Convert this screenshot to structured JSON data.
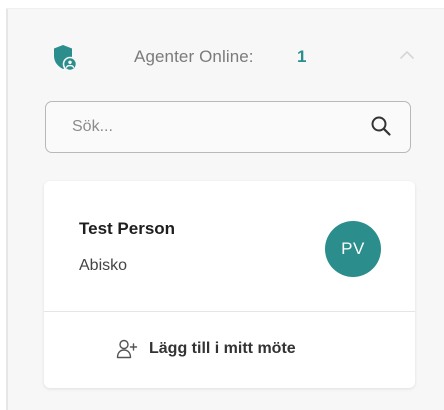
{
  "header": {
    "icon": "shield-user-icon",
    "label": "Agenter Online:",
    "count": "1",
    "collapse_icon": "chevron-up-icon"
  },
  "search": {
    "placeholder": "Sök...",
    "value": "",
    "icon": "search-icon"
  },
  "agents": [
    {
      "name": "Test Person",
      "location": "Abisko",
      "initials": "PV",
      "add_action": {
        "icon": "add-user-icon",
        "label": "Lägg till i mitt möte"
      }
    }
  ],
  "colors": {
    "accent": "#2b8e8c",
    "panel_bg": "#f7f7f7",
    "card_bg": "#ffffff",
    "muted_text": "#7b7b7b"
  }
}
